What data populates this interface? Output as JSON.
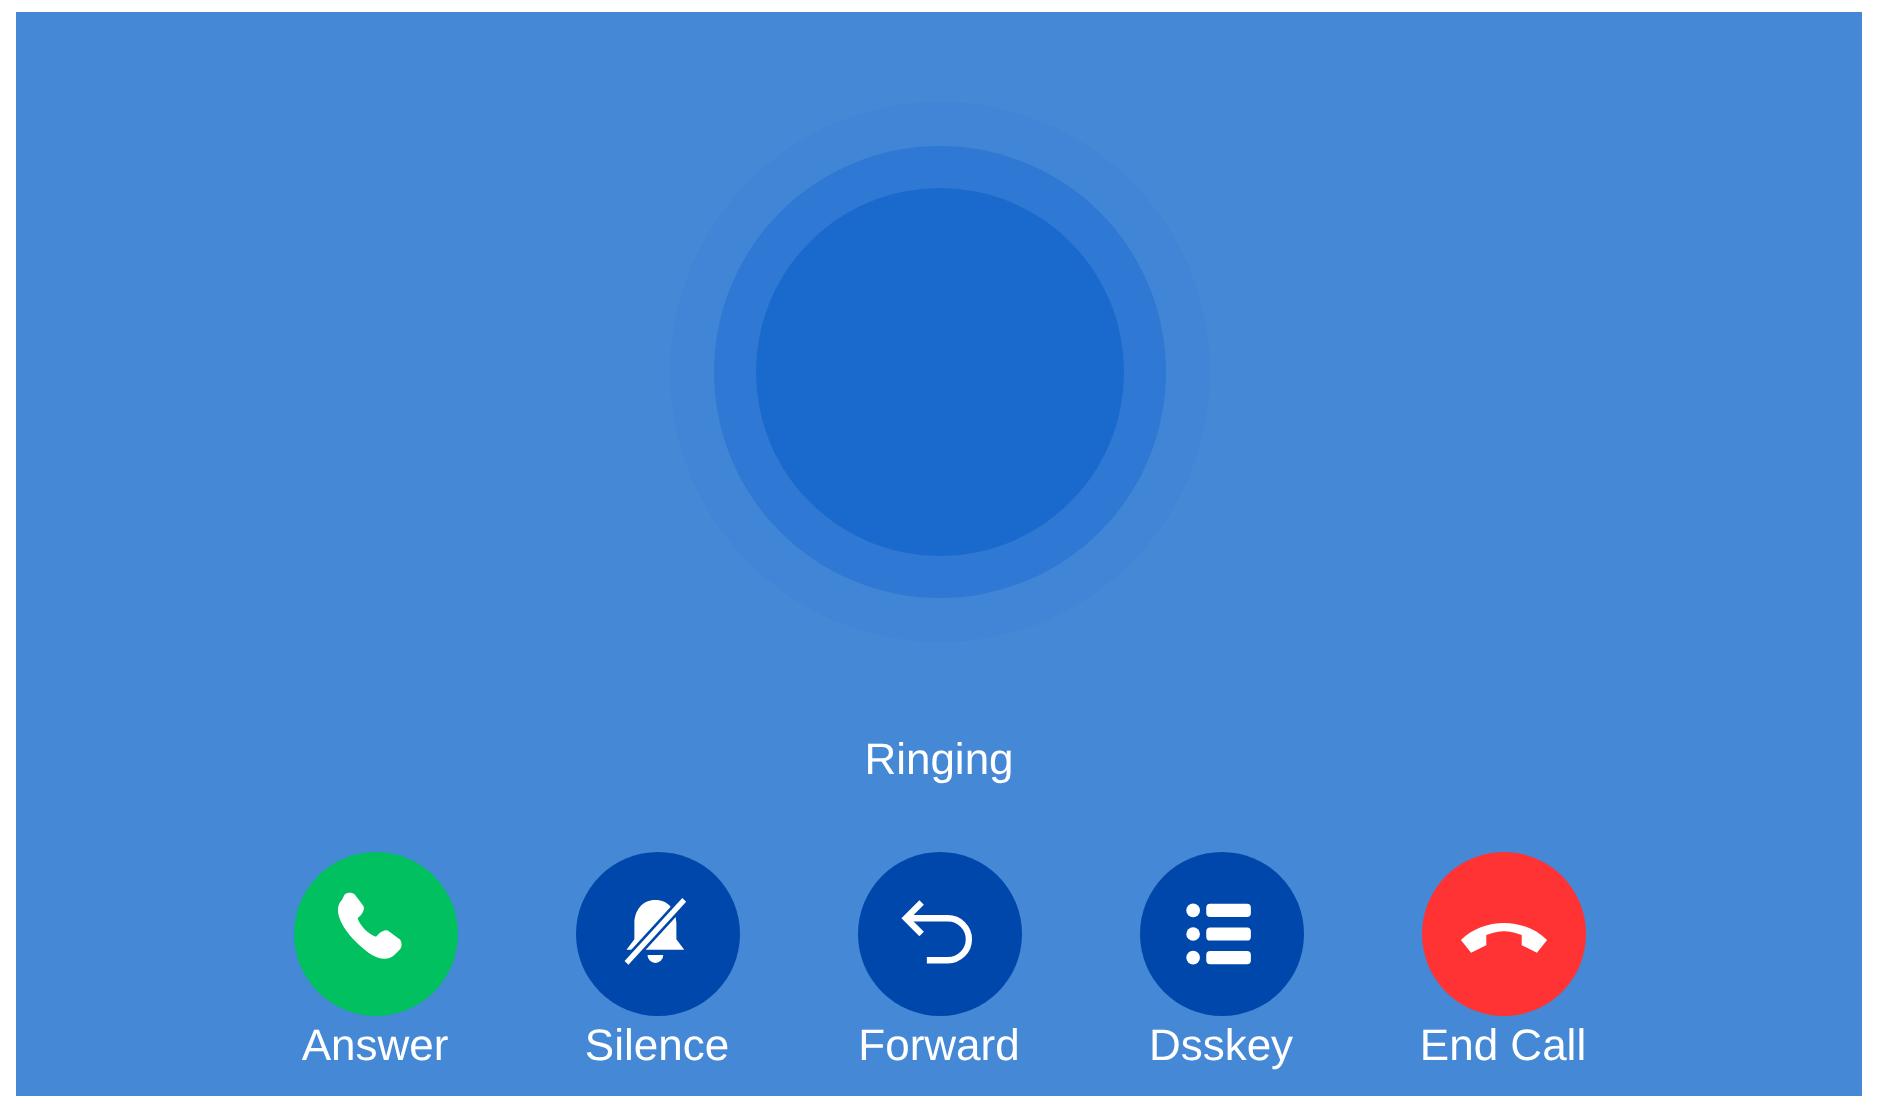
{
  "status": "Ringing",
  "actions": [
    {
      "kind": "answer",
      "label": "Answer",
      "color": "#00c060"
    },
    {
      "kind": "silence",
      "label": "Silence",
      "color": "#0047ab"
    },
    {
      "kind": "forward",
      "label": "Forward",
      "color": "#0047ab"
    },
    {
      "kind": "dsskey",
      "label": "Dsskey",
      "color": "#0047ab"
    },
    {
      "kind": "end",
      "label": "End Call",
      "color": "#ff3333"
    }
  ]
}
